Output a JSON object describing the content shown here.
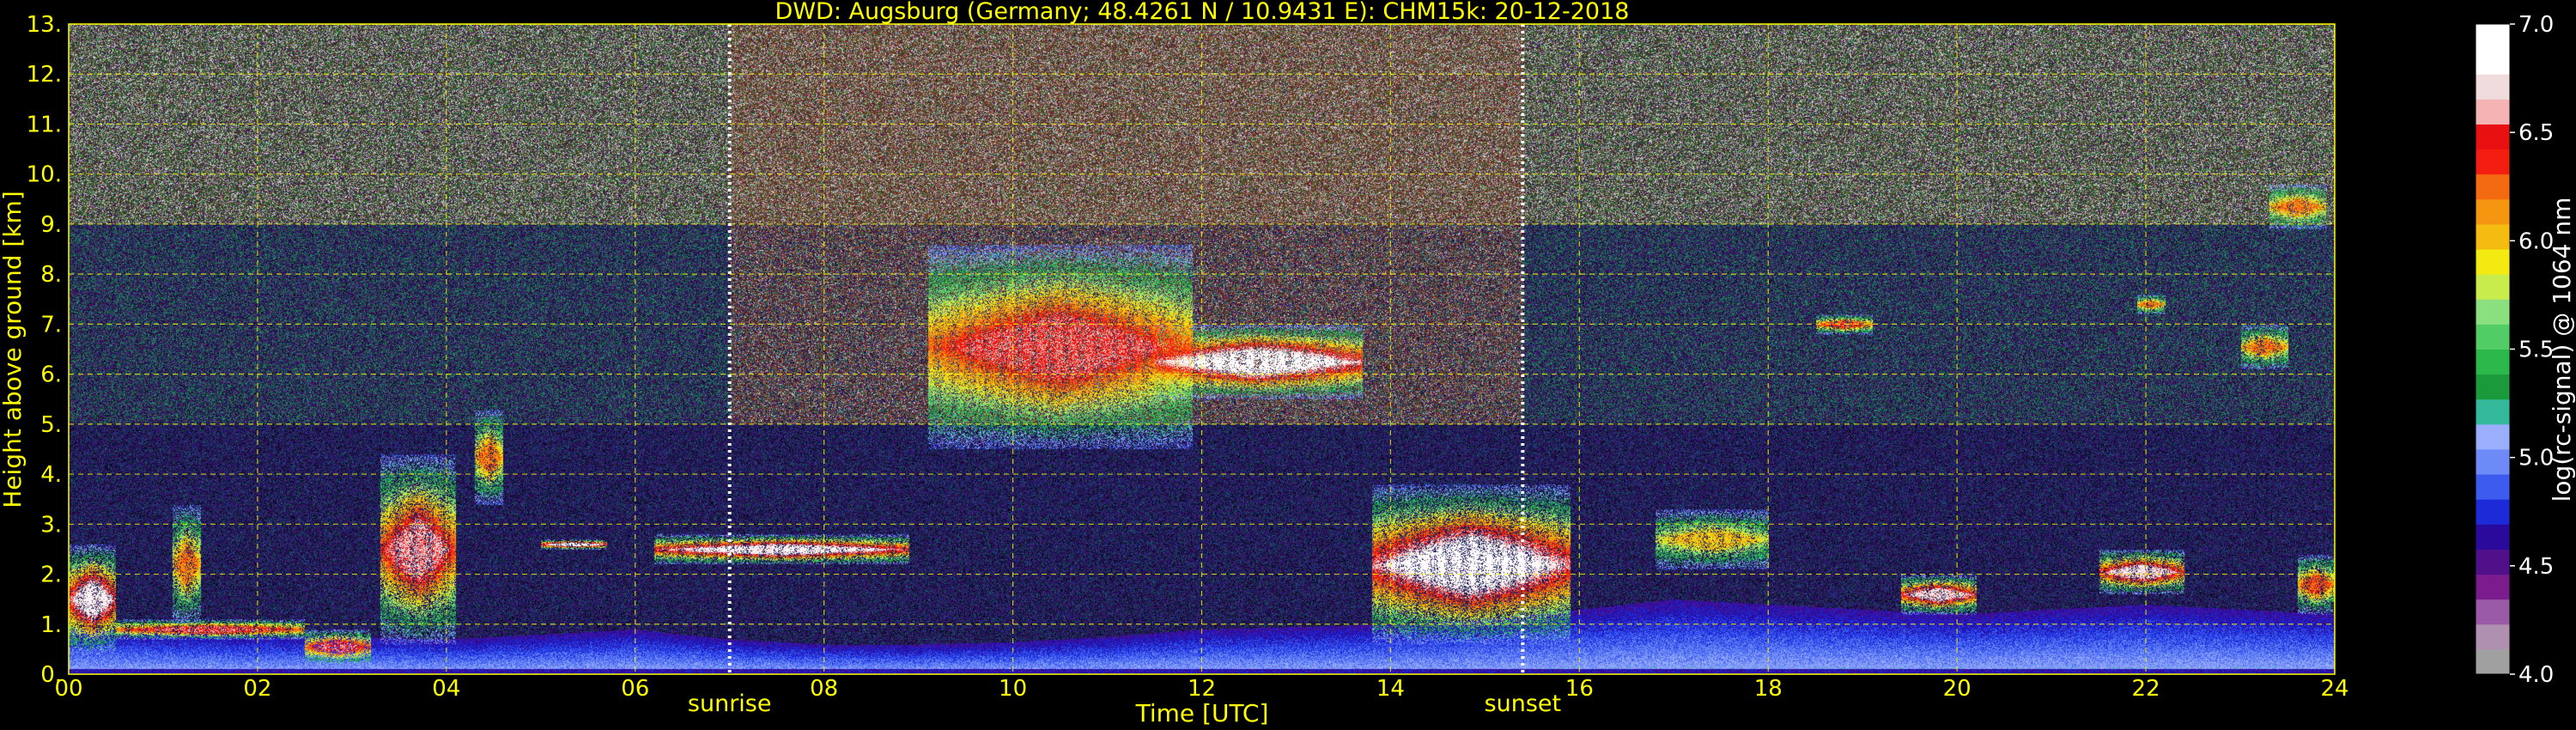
{
  "chart_data": {
    "type": "heatmap",
    "title": "DWD: Augsburg (Germany; 48.4261 N / 10.9431 E):    CHM15k: 20-12-2018",
    "xlabel": "Time [UTC]",
    "ylabel": "Height above ground [km]",
    "xlim": [
      0,
      24
    ],
    "ylim": [
      0,
      13
    ],
    "x_ticks": [
      0,
      2,
      4,
      6,
      8,
      10,
      12,
      14,
      16,
      18,
      20,
      22,
      24
    ],
    "x_tick_labels": [
      "00",
      "02",
      "04",
      "06",
      "08",
      "10",
      "12",
      "14",
      "16",
      "18",
      "20",
      "22",
      "24"
    ],
    "y_ticks": [
      0,
      1,
      2,
      3,
      4,
      5,
      6,
      7,
      8,
      9,
      10,
      11,
      12,
      13
    ],
    "y_tick_labels": [
      "0.",
      "1.",
      "2.",
      "3.",
      "4.",
      "5.",
      "6.",
      "7.",
      "8.",
      "9.",
      "10.",
      "11.",
      "12.",
      "13."
    ],
    "grid": true,
    "grid_color": "#ffff00",
    "colorbar": {
      "label": "log(rc-signal) @ 1064 nm",
      "range": [
        4.0,
        7.0
      ],
      "ticks": [
        4.0,
        4.5,
        5.0,
        5.5,
        6.0,
        6.5,
        7.0
      ],
      "tick_labels": [
        "4.0",
        "4.5",
        "5.0",
        "5.5",
        "6.0",
        "6.5",
        "7.0"
      ],
      "colors": [
        "#a0a0a0",
        "#b090b0",
        "#9a5aa6",
        "#7a1c8e",
        "#50108a",
        "#2a0a9c",
        "#1c2ad8",
        "#3c5cf0",
        "#6e8af6",
        "#9aaefc",
        "#34b89c",
        "#1a9a3a",
        "#2cb84a",
        "#52cc64",
        "#8ae07e",
        "#c8ec4c",
        "#f2ea10",
        "#f4bc10",
        "#f49610",
        "#f46a10",
        "#f41e10",
        "#e81010",
        "#f4b4b4",
        "#f0dcdc",
        "#ffffff",
        "#ffffff"
      ]
    },
    "vertical_markers": [
      {
        "x": 7.0,
        "label": "sunrise"
      },
      {
        "x": 15.4,
        "label": "sunset"
      }
    ],
    "features": {
      "boundary_layer_top": [
        {
          "time": 0.0,
          "height": 0.9
        },
        {
          "time": 1.0,
          "height": 0.85
        },
        {
          "time": 2.0,
          "height": 0.8
        },
        {
          "time": 3.0,
          "height": 0.75
        },
        {
          "time": 4.0,
          "height": 0.7
        },
        {
          "time": 5.0,
          "height": 0.8
        },
        {
          "time": 6.0,
          "height": 0.9
        },
        {
          "time": 7.0,
          "height": 0.7
        },
        {
          "time": 8.0,
          "height": 0.6
        },
        {
          "time": 9.0,
          "height": 0.6
        },
        {
          "time": 10.0,
          "height": 0.65
        },
        {
          "time": 11.0,
          "height": 0.75
        },
        {
          "time": 12.0,
          "height": 0.9
        },
        {
          "time": 13.0,
          "height": 0.95
        },
        {
          "time": 14.0,
          "height": 1.0
        },
        {
          "time": 15.0,
          "height": 1.1
        },
        {
          "time": 16.0,
          "height": 1.3
        },
        {
          "time": 17.0,
          "height": 1.5
        },
        {
          "time": 18.0,
          "height": 1.4
        },
        {
          "time": 19.0,
          "height": 1.3
        },
        {
          "time": 20.0,
          "height": 1.2
        },
        {
          "time": 21.0,
          "height": 1.3
        },
        {
          "time": 22.0,
          "height": 1.4
        },
        {
          "time": 23.0,
          "height": 1.3
        },
        {
          "time": 24.0,
          "height": 1.2
        }
      ],
      "cloud_layers": [
        {
          "t_start": 0.0,
          "t_end": 0.5,
          "base": 0.4,
          "top": 2.6,
          "peak": 6.8
        },
        {
          "t_start": 0.5,
          "t_end": 2.5,
          "base": 0.7,
          "top": 1.1,
          "peak": 6.5
        },
        {
          "t_start": 1.1,
          "t_end": 1.4,
          "base": 1.0,
          "top": 3.4,
          "peak": 6.2
        },
        {
          "t_start": 2.5,
          "t_end": 3.2,
          "base": 0.2,
          "top": 0.9,
          "peak": 6.5
        },
        {
          "t_start": 3.3,
          "t_end": 4.1,
          "base": 0.6,
          "top": 4.4,
          "peak": 6.6
        },
        {
          "t_start": 4.3,
          "t_end": 4.6,
          "base": 3.4,
          "top": 5.3,
          "peak": 6.2
        },
        {
          "t_start": 5.0,
          "t_end": 5.7,
          "base": 2.5,
          "top": 2.7,
          "peak": 6.9
        },
        {
          "t_start": 6.2,
          "t_end": 8.9,
          "base": 2.2,
          "top": 2.8,
          "peak": 6.8
        },
        {
          "t_start": 9.1,
          "t_end": 11.9,
          "base": 4.5,
          "top": 8.6,
          "peak": 6.5
        },
        {
          "t_start": 11.5,
          "t_end": 13.7,
          "base": 5.5,
          "top": 7.0,
          "peak": 6.9
        },
        {
          "t_start": 13.8,
          "t_end": 15.9,
          "base": 0.6,
          "top": 3.8,
          "peak": 6.9
        },
        {
          "t_start": 16.8,
          "t_end": 18.0,
          "base": 2.1,
          "top": 3.3,
          "peak": 6.0
        },
        {
          "t_start": 18.5,
          "t_end": 19.1,
          "base": 6.8,
          "top": 7.2,
          "peak": 6.4
        },
        {
          "t_start": 19.4,
          "t_end": 20.2,
          "base": 1.2,
          "top": 2.0,
          "peak": 6.7
        },
        {
          "t_start": 21.5,
          "t_end": 22.4,
          "base": 1.6,
          "top": 2.5,
          "peak": 6.7
        },
        {
          "t_start": 21.9,
          "t_end": 22.2,
          "base": 7.2,
          "top": 7.6,
          "peak": 6.2
        },
        {
          "t_start": 23.0,
          "t_end": 23.5,
          "base": 6.1,
          "top": 7.0,
          "peak": 6.2
        },
        {
          "t_start": 23.3,
          "t_end": 23.9,
          "base": 8.9,
          "top": 9.8,
          "peak": 6.2
        },
        {
          "t_start": 23.6,
          "t_end": 24.0,
          "base": 1.2,
          "top": 2.4,
          "peak": 6.3
        }
      ]
    }
  }
}
